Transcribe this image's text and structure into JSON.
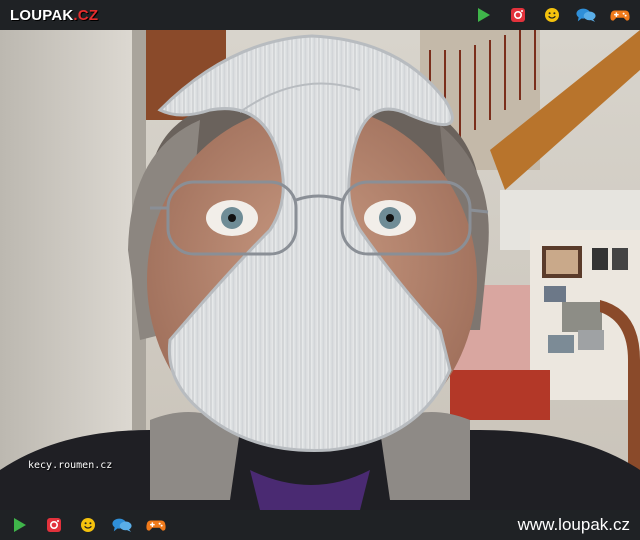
{
  "header": {
    "logo_main": "LOUPAK",
    "logo_suffix": ".CZ",
    "icons": [
      "play-icon",
      "instagram-icon",
      "smiley-icon",
      "chat-icon",
      "gamepad-icon"
    ]
  },
  "photo": {
    "watermark": "kecy.roumen.cz"
  },
  "footer": {
    "icons": [
      "play-icon",
      "instagram-icon",
      "smiley-icon",
      "chat-icon",
      "gamepad-icon"
    ],
    "url": "www.loupak.cz"
  },
  "colors": {
    "bar_bg": "#1f2225",
    "play": "#3fb54a",
    "instagram": "#e2323c",
    "smiley": "#f4c20d",
    "chat": "#2f8fd8",
    "gamepad": "#f07a1a",
    "logo_accent": "#e52d2d"
  }
}
